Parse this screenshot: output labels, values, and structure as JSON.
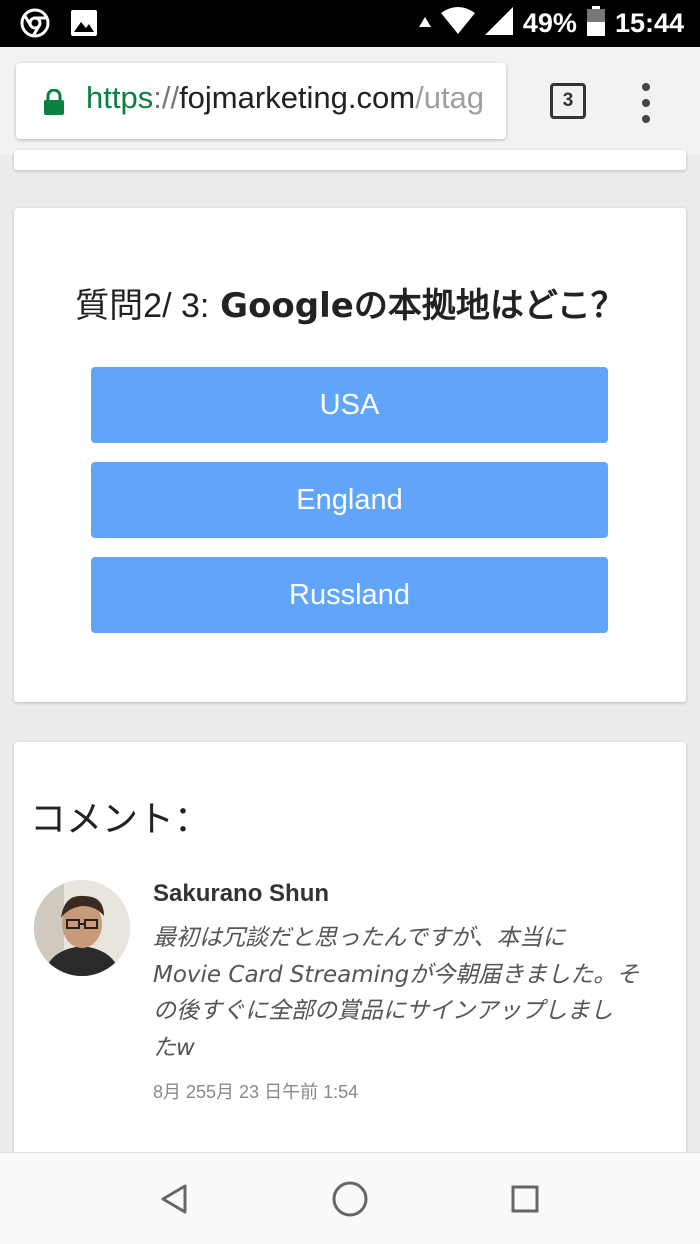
{
  "status_bar": {
    "battery": "49%",
    "time": "15:44"
  },
  "browser": {
    "url_scheme": "https",
    "url_sep": "://",
    "url_host": "fojmarketing.com",
    "url_path": "/utag",
    "tab_count": "3"
  },
  "quiz": {
    "question_label": "質問",
    "question_number": "2/ 3:",
    "question_text": "Googleの本拠地はどこ？",
    "answers": [
      "USA",
      "England",
      "Russland"
    ]
  },
  "comments": {
    "heading": "コメント：",
    "items": [
      {
        "author": "Sakurano Shun",
        "body_lines": [
          "最初は冗談だと思ったんですが、本当に",
          "Movie Card Streamingが今朝届きました。そ",
          "の後すぐに全部の賞品にサインアップしまし",
          "たw"
        ],
        "time": "8月 255月 23 日午前 1:54"
      }
    ]
  },
  "colors": {
    "answer_button": "#61a5fa",
    "url_secure": "#0b8043"
  }
}
